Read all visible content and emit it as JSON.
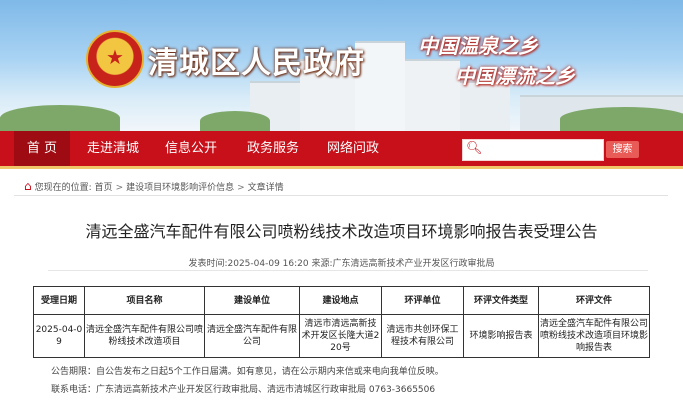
{
  "header": {
    "site_title": "清城区人民政府",
    "emblem_glyph": "★",
    "slogans": [
      "中国温泉之乡",
      "中国漂流之乡"
    ]
  },
  "nav": {
    "items": [
      "首 页",
      "走进清城",
      "信息公开",
      "政务服务",
      "网络问政"
    ],
    "active_index": 0,
    "search_placeholder": "",
    "search_button": "搜索"
  },
  "breadcrumb": {
    "prefix": "您现在的位置:",
    "items": [
      "首页",
      "建设项目环境影响评价信息",
      "文章详情"
    ],
    "separator": ">"
  },
  "article": {
    "title": "清远全盛汽车配件有限公司喷粉线技术改造项目环境影响报告表受理公告",
    "publish_label": "发表时间:",
    "publish_time": "2025-04-09 16:20",
    "source_label": "来源:",
    "source": "广东清远高新技术产业开发区行政审批局"
  },
  "table": {
    "headers": [
      "受理日期",
      "项目名称",
      "建设单位",
      "建设地点",
      "环评单位",
      "环评文件类型",
      "环评文件"
    ],
    "rows": [
      [
        "2025-04-09",
        "清远全盛汽车配件有限公司喷粉线技术改造项目",
        "清远全盛汽车配件有限公司",
        "清远市清远高新技术开发区长隆大道220号",
        "清远市共创环保工程技术有限公司",
        "环境影响报告表",
        "清远全盛汽车配件有限公司喷粉线技术改造项目环境影响报告表"
      ]
    ]
  },
  "notes": {
    "period": "公告期限：自公告发布之日起5个工作日届满。如有意见，请在公示期内来信或来电向我单位反映。",
    "contact": "联系电话：广东清远高新技术产业开发区行政审批局、清远市清城区行政审批局 0763-3665506"
  },
  "colors": {
    "nav_bg": "#c8101a",
    "nav_active": "#9f0b12",
    "accent_border": "#f0c56a",
    "search_button": "#e85b57"
  }
}
